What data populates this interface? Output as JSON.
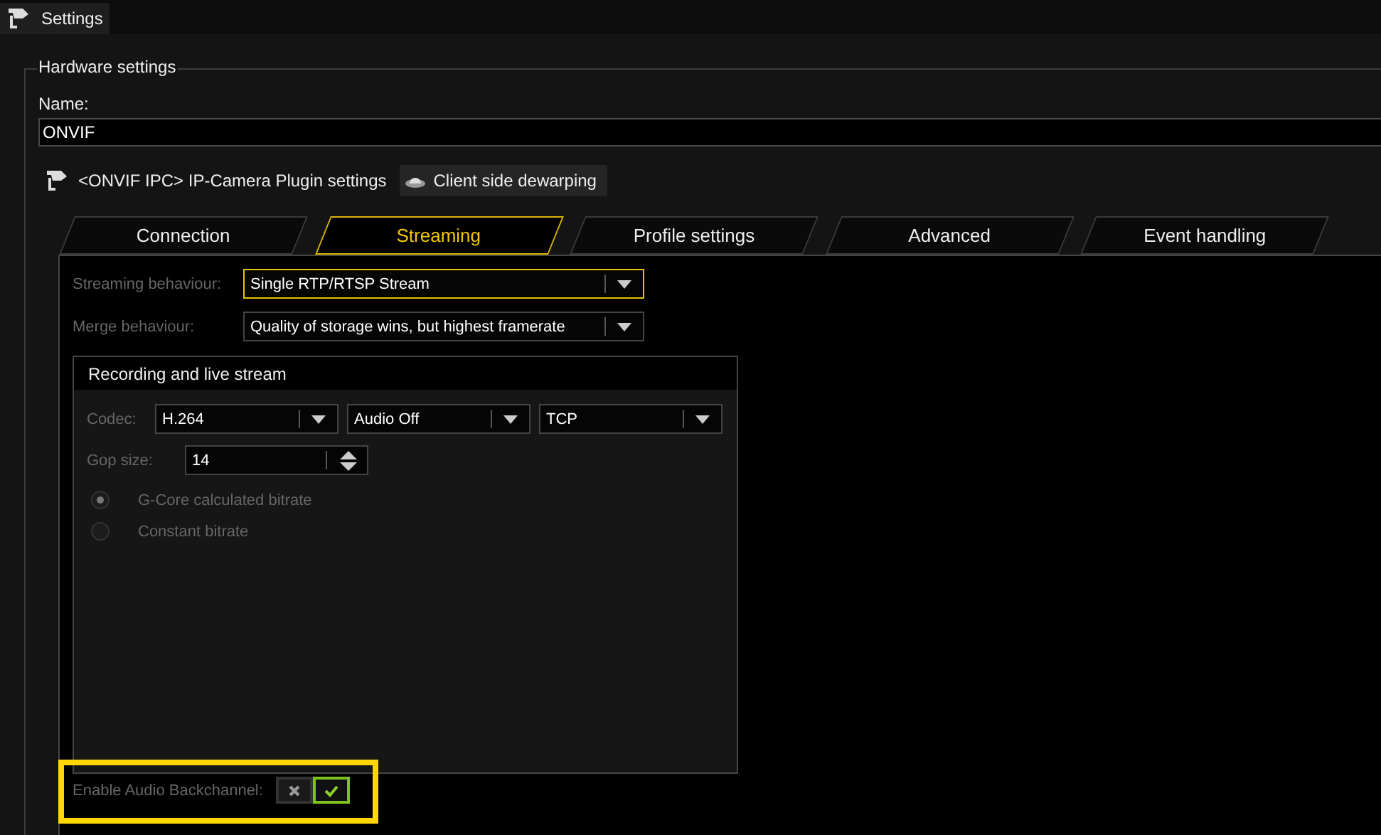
{
  "window": {
    "title": "Settings"
  },
  "hardware_settings": {
    "title": "Hardware settings",
    "name_label": "Name:",
    "name_value": "ONVIF",
    "plugin_buttons": [
      {
        "label": "<ONVIF IPC> IP-Camera Plugin settings",
        "kind": "camera"
      },
      {
        "label": "Client side dewarping",
        "kind": "dome"
      }
    ]
  },
  "tabs": [
    {
      "label": "Connection",
      "selected": false
    },
    {
      "label": "Streaming",
      "selected": true
    },
    {
      "label": "Profile settings",
      "selected": false
    },
    {
      "label": "Advanced",
      "selected": false
    },
    {
      "label": "Event handling",
      "selected": false
    }
  ],
  "streaming_fields": [
    {
      "label": "Streaming behaviour:",
      "value": "Single RTP/RTSP Stream",
      "focused": true
    },
    {
      "label": "Merge behaviour:",
      "value": "Quality of storage wins, but highest framerate",
      "focused": false
    }
  ],
  "recording_group": {
    "title": "Recording and live stream",
    "codec_label": "Codec:",
    "codec_dropdowns": [
      "H.264",
      "Audio Off",
      "TCP"
    ],
    "gop_label": "Gop size:",
    "gop_value": "14",
    "bitrate_options": [
      {
        "label": "G-Core calculated bitrate",
        "selected": true
      },
      {
        "label": "Constant bitrate",
        "selected": false
      }
    ]
  },
  "audio_backchannel": {
    "label": "Enable Audio Backchannel:",
    "on": true,
    "highlighted": true
  }
}
